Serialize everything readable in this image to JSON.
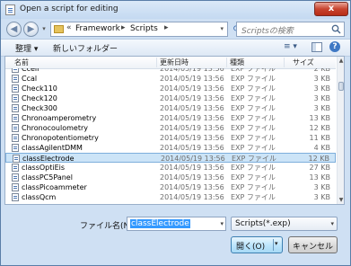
{
  "window": {
    "title": "Open a script for editing",
    "close_glyph": "x"
  },
  "address": {
    "prefix": "«",
    "segments": [
      "Framework",
      "Scripts"
    ],
    "separator": "▸",
    "refresh_icon": "refresh-icon"
  },
  "search": {
    "placeholder": "Scriptsの検索"
  },
  "toolbar": {
    "organize_label": "整理 ▾",
    "new_folder_label": "新しいフォルダー",
    "view_label": "≡ ▾",
    "help_label": "?"
  },
  "columns": {
    "name": "名前",
    "date": "更新日時",
    "type": "種類",
    "size": "サイズ"
  },
  "files": [
    {
      "name": "Ccell",
      "date": "2014/05/19 13:56",
      "type": "EXP ファイル",
      "size": "2 KB",
      "selected": false
    },
    {
      "name": "Ccal",
      "date": "2014/05/19 13:56",
      "type": "EXP ファイル",
      "size": "3 KB",
      "selected": false
    },
    {
      "name": "Check110",
      "date": "2014/05/19 13:56",
      "type": "EXP ファイル",
      "size": "3 KB",
      "selected": false
    },
    {
      "name": "Check120",
      "date": "2014/05/19 13:56",
      "type": "EXP ファイル",
      "size": "3 KB",
      "selected": false
    },
    {
      "name": "Check300",
      "date": "2014/05/19 13:56",
      "type": "EXP ファイル",
      "size": "3 KB",
      "selected": false
    },
    {
      "name": "Chronoamperometry",
      "date": "2014/05/19 13:56",
      "type": "EXP ファイル",
      "size": "13 KB",
      "selected": false
    },
    {
      "name": "Chronocoulometry",
      "date": "2014/05/19 13:56",
      "type": "EXP ファイル",
      "size": "12 KB",
      "selected": false
    },
    {
      "name": "Chronopotentiometry",
      "date": "2014/05/19 13:56",
      "type": "EXP ファイル",
      "size": "11 KB",
      "selected": false
    },
    {
      "name": "classAgilentDMM",
      "date": "2014/05/19 13:56",
      "type": "EXP ファイル",
      "size": "4 KB",
      "selected": false
    },
    {
      "name": "classElectrode",
      "date": "2014/05/19 13:56",
      "type": "EXP ファイル",
      "size": "12 KB",
      "selected": true
    },
    {
      "name": "classOptiEis",
      "date": "2014/05/19 13:56",
      "type": "EXP ファイル",
      "size": "27 KB",
      "selected": false
    },
    {
      "name": "classPC5Panel",
      "date": "2014/05/19 13:56",
      "type": "EXP ファイル",
      "size": "13 KB",
      "selected": false
    },
    {
      "name": "classPicoammeter",
      "date": "2014/05/19 13:56",
      "type": "EXP ファイル",
      "size": "3 KB",
      "selected": false
    },
    {
      "name": "classQcm",
      "date": "2014/05/19 13:56",
      "type": "EXP ファイル",
      "size": "3 KB",
      "selected": false
    }
  ],
  "footer": {
    "filename_label": "ファイル名(N):",
    "filename_value": "classElectrode",
    "type_value": "Scripts(*.exp)",
    "open_label": "開く(O)",
    "cancel_label": "キャンセル"
  }
}
